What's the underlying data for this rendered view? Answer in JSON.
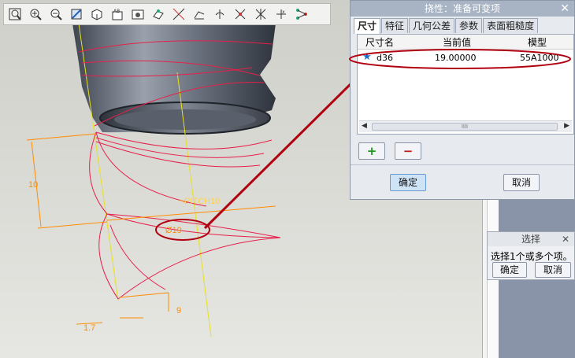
{
  "toolbar": {
    "icons": [
      "zoom-window-icon",
      "zoom-in-icon",
      "zoom-out-icon",
      "refit-icon",
      "orient-icon",
      "repaint-icon",
      "saved-views-icon",
      "datum-plane-icon",
      "datum-axis-icon",
      "datum-point-icon",
      "coord-sys-icon",
      "spin-center-icon",
      "annotation-icon",
      "datum-tag-icon",
      "model-tree-icon"
    ]
  },
  "properties_dialog": {
    "title": "挠性：准备可变项",
    "close": "✕",
    "tabs": [
      "尺寸",
      "特征",
      "几何公差",
      "参数",
      "表面粗糙度"
    ],
    "columns": [
      "尺寸名",
      "当前值",
      "模型"
    ],
    "rows": [
      {
        "name": "d36",
        "value": "19.00000",
        "model": "55A1000"
      }
    ],
    "scroll_thumb": "IIII",
    "add_label": "+",
    "remove_label": "−",
    "ok_label": "确定",
    "cancel_label": "取消"
  },
  "select_dialog": {
    "title": "选择",
    "close": "✕",
    "prompt": "选择1个或多个项。",
    "ok_label": "确定",
    "cancel_label": "取消"
  },
  "model_annotations": {
    "dim_height": "10",
    "pitch": "PITCH10",
    "diameter": "Ø19",
    "dim_bottom": "9",
    "dim_left": "1.7"
  },
  "colors": {
    "dimension": "#ff8c00",
    "curve": "#e8204a",
    "axis": "#e8e020",
    "callout": "#b00010",
    "solid": "#6f7682"
  }
}
